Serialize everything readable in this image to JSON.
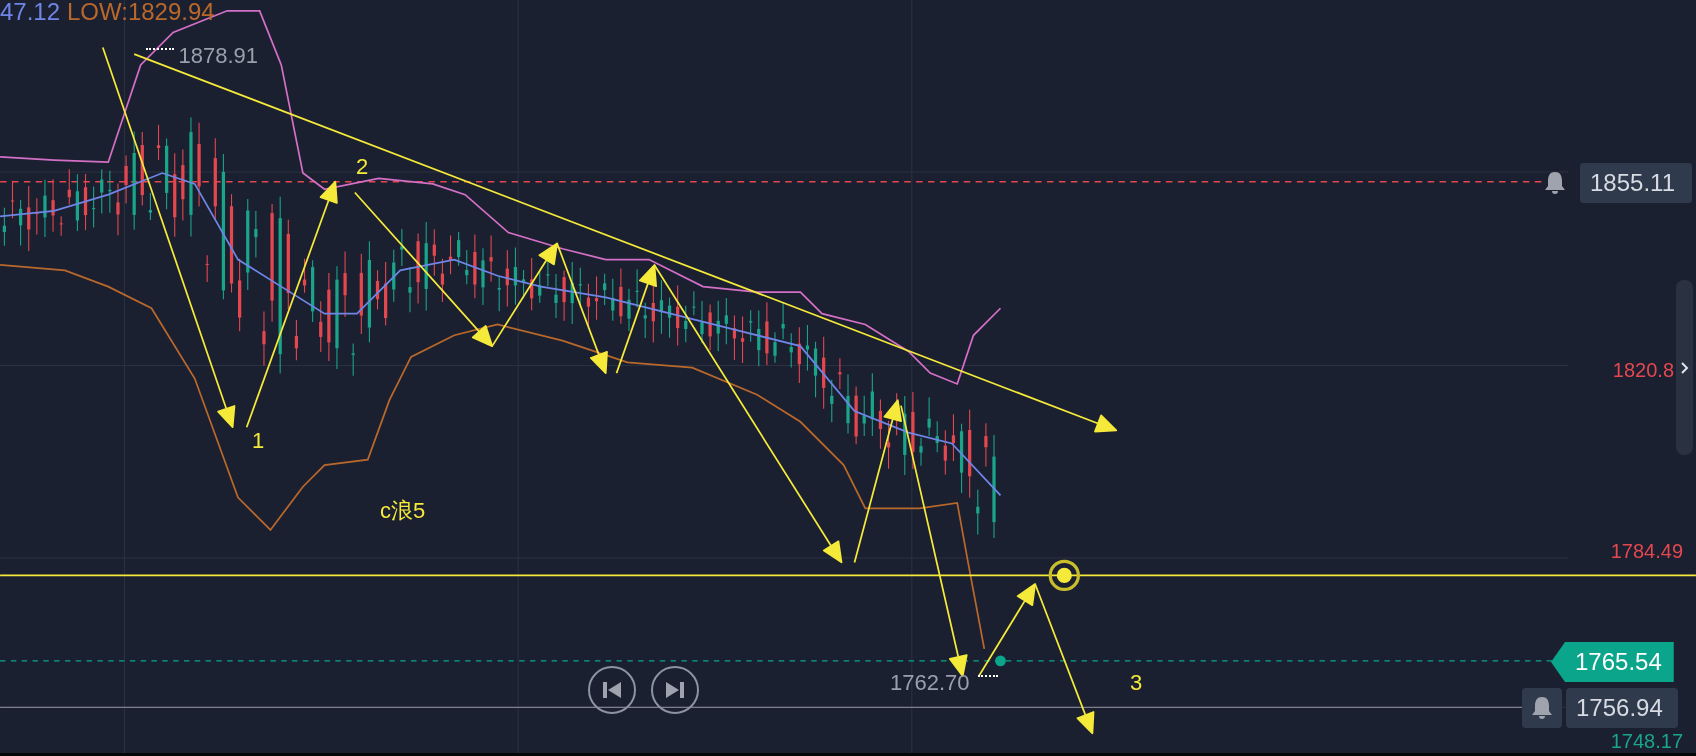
{
  "legend": {
    "mid": "47.12",
    "low": "LOW:1829.94"
  },
  "markers": [
    {
      "kind": "high",
      "value": "1878.91"
    },
    {
      "kind": "low",
      "value": "1762.70"
    }
  ],
  "wave_labels": [
    {
      "text": "1"
    },
    {
      "text": "2"
    },
    {
      "text": "3"
    },
    {
      "text": "c浪5"
    }
  ],
  "price_axis": [
    {
      "kind": "alert",
      "value": "1855.11"
    },
    {
      "kind": "axis",
      "value": "1820.8",
      "color": "#e5474f"
    },
    {
      "kind": "axis",
      "value": "1784.49",
      "color": "#e5474f"
    },
    {
      "kind": "current",
      "value": "1765.54"
    },
    {
      "kind": "alert",
      "value": "1756.94"
    },
    {
      "kind": "axis",
      "value": "1748.17",
      "color": "#1aa58a"
    }
  ]
}
